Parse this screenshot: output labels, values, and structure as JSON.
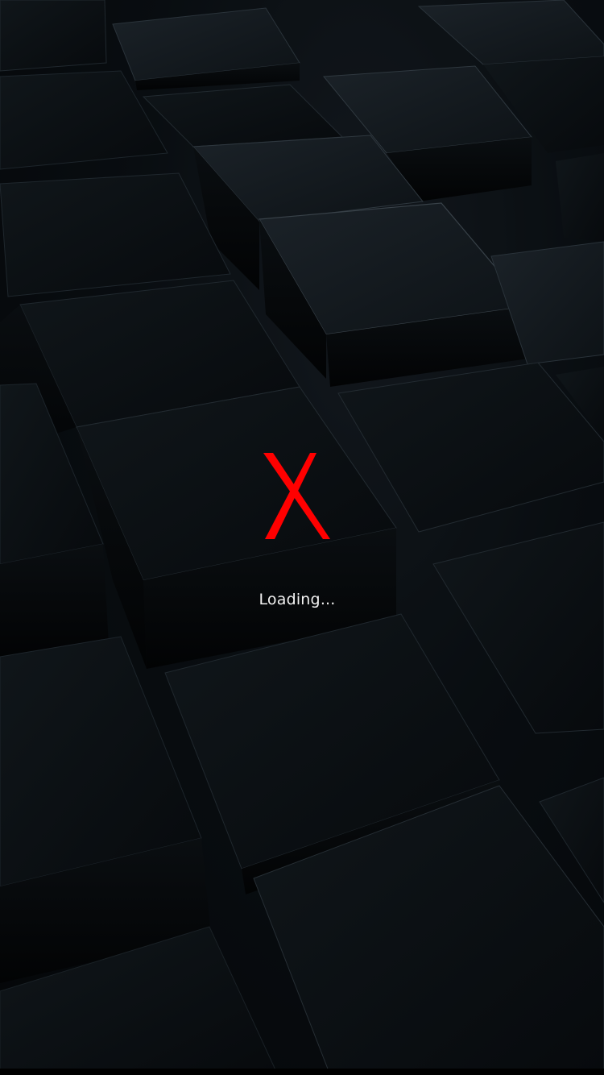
{
  "splash": {
    "logo_letter": "X",
    "loading_text": "Loading...",
    "logo_icon": "red-x-logo",
    "background_icon": "dark-3d-cubes-wallpaper"
  },
  "colors": {
    "logo": "#ff0000",
    "text": "#f2f2f2",
    "background": "#0b1014"
  }
}
